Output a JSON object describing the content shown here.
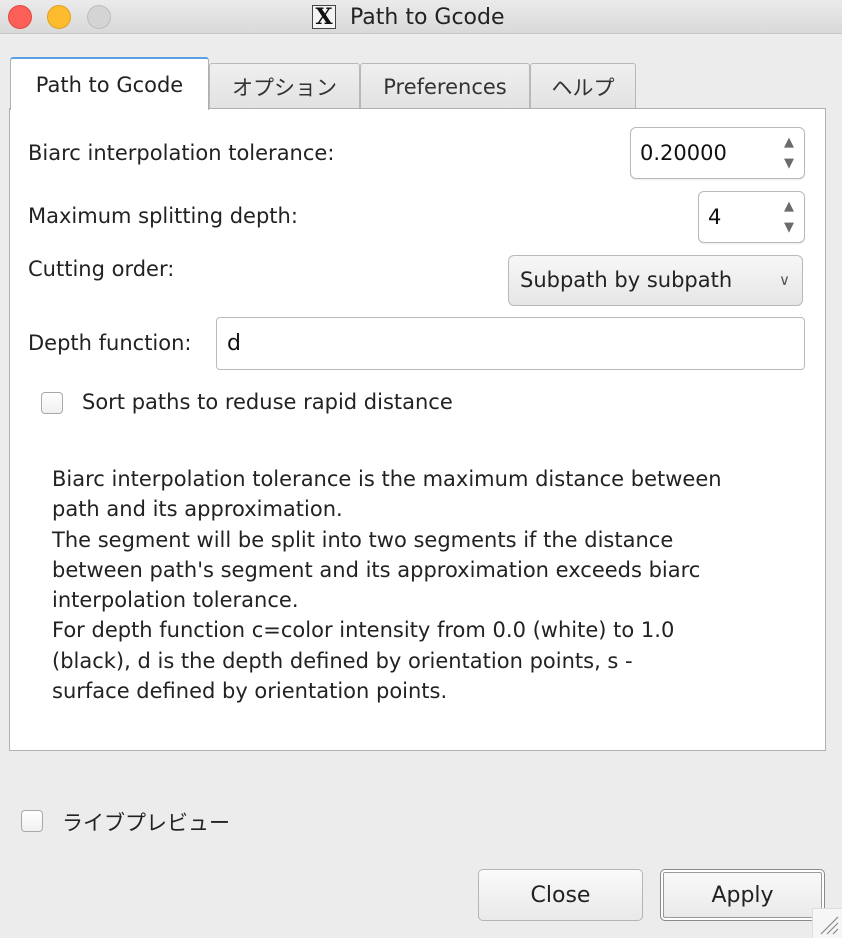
{
  "window": {
    "title": "Path to Gcode",
    "title_icon": "X"
  },
  "tabs": [
    {
      "label": "Path to Gcode",
      "active": true
    },
    {
      "label": "オプション",
      "active": false
    },
    {
      "label": "Preferences",
      "active": false
    },
    {
      "label": "ヘルプ",
      "active": false
    }
  ],
  "form": {
    "biarc_label": "Biarc interpolation tolerance:",
    "biarc_value": "0.20000",
    "split_label": "Maximum splitting depth:",
    "split_value": "4",
    "cutting_label": "Cutting order:",
    "cutting_value": "Subpath by subpath",
    "depth_label": "Depth function:",
    "depth_value": "d",
    "sort_label": "Sort paths to reduse rapid distance",
    "sort_checked": false
  },
  "help_text": "Biarc interpolation tolerance is the maximum distance between\npath and its approximation.\nThe segment will be split into two segments if the distance\nbetween path's segment and its approximation exceeds biarc\ninterpolation tolerance.\nFor depth function c=color intensity from 0.0 (white) to 1.0\n(black), d is the depth defined by orientation points, s -\nsurface defined by orientation points.",
  "live_preview": {
    "label": "ライブプレビュー",
    "checked": false
  },
  "buttons": {
    "close": "Close",
    "apply": "Apply"
  },
  "colors": {
    "close_light": "#fc5f57",
    "minimize_light": "#fdbc2e",
    "maximize_light": "#d4d4d4",
    "tab_focus": "#5aa0e6"
  }
}
